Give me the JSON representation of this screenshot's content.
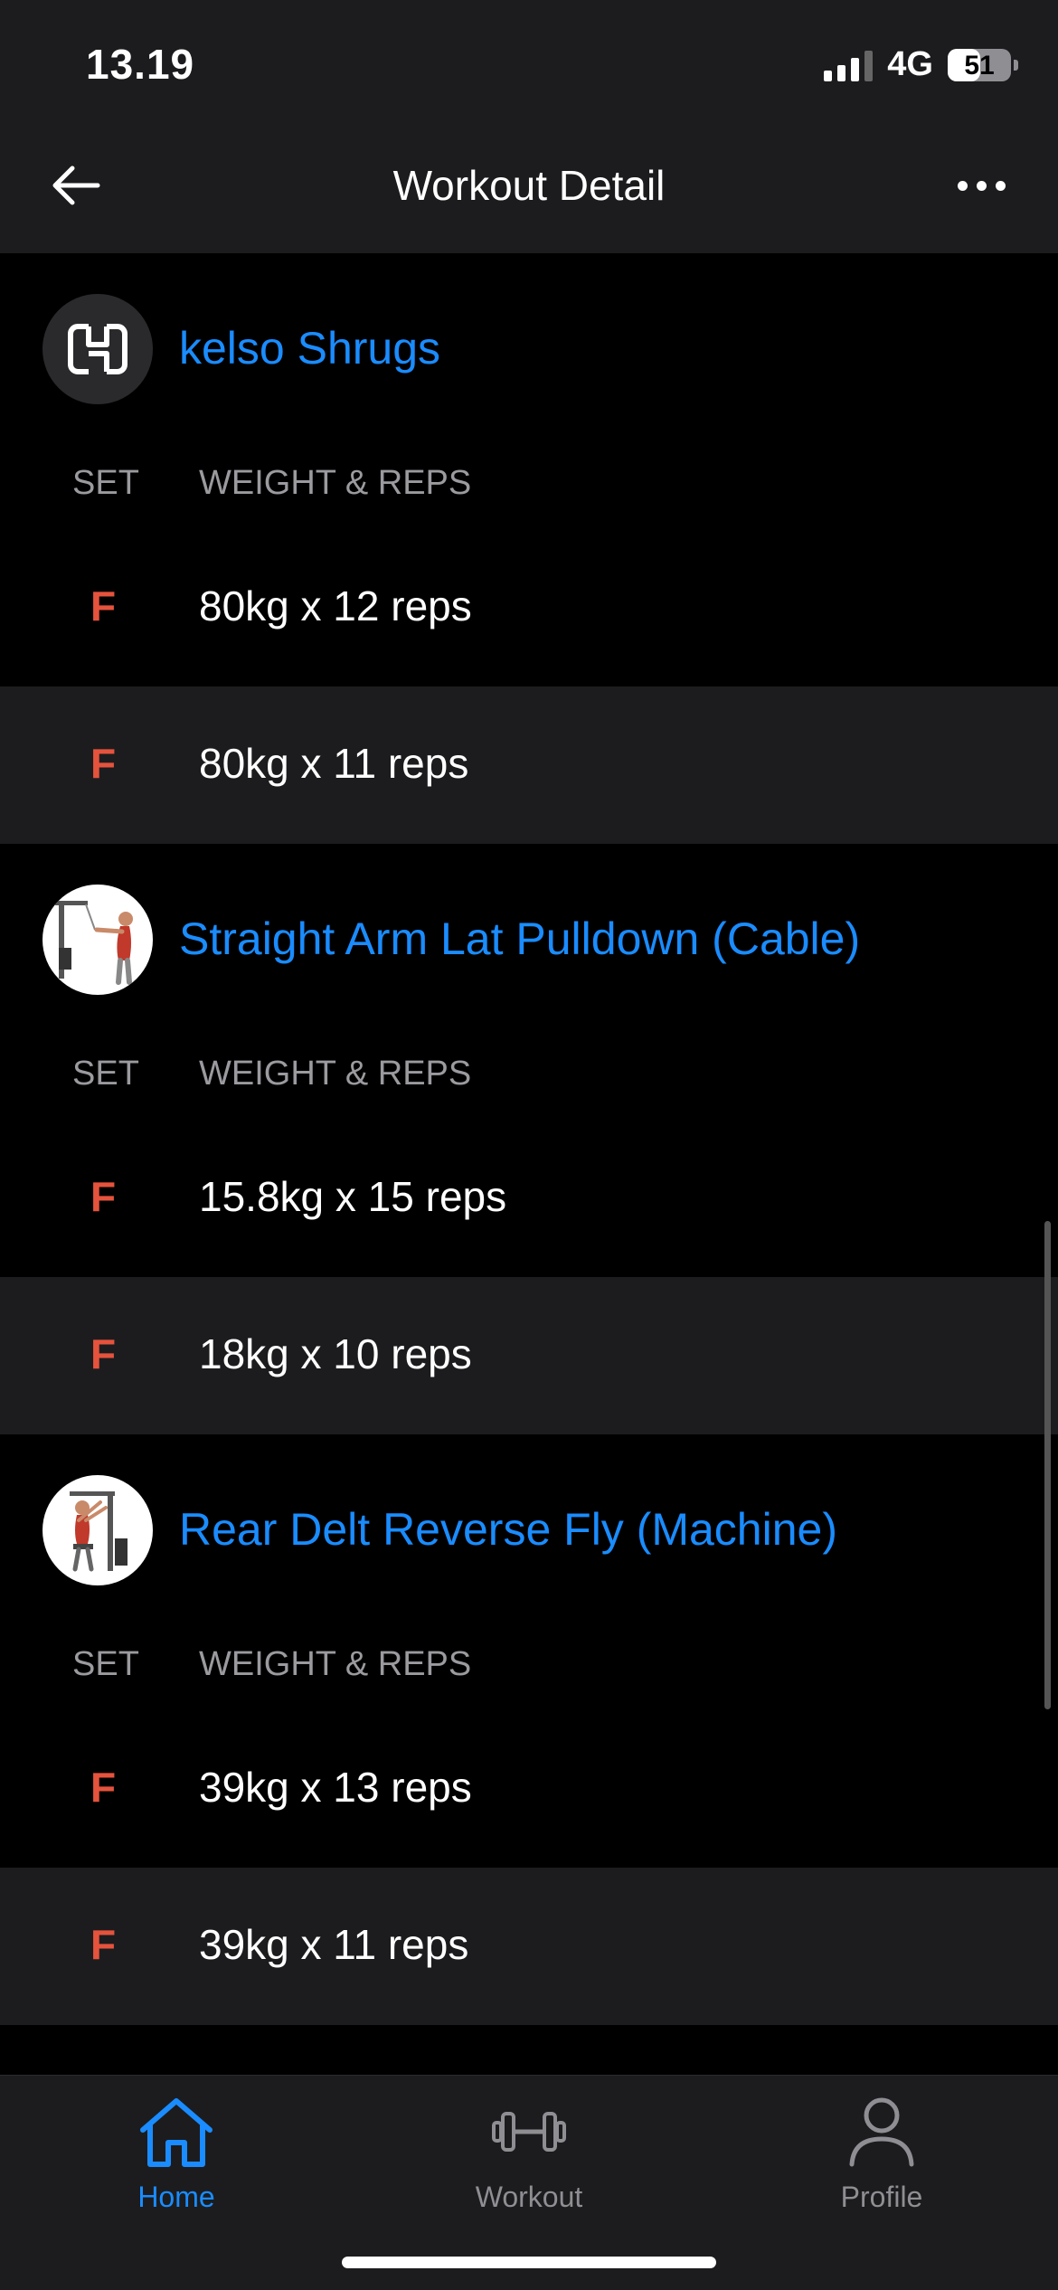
{
  "status_bar": {
    "time": "13.19",
    "network": "4G",
    "battery": "51",
    "battery_level": 0.51
  },
  "nav": {
    "title": "Workout Detail",
    "back_icon": "arrow-left-icon",
    "more_icon": "more-horizontal-icon"
  },
  "column_headers": {
    "set": "SET",
    "weight_reps": "WEIGHT & REPS"
  },
  "exercises": [
    {
      "name": "kelso Shrugs",
      "thumb_icon": "hevy-logo-icon",
      "sets": [
        {
          "type": "F",
          "value": "80kg x 12 reps"
        },
        {
          "type": "F",
          "value": "80kg x 11 reps"
        }
      ]
    },
    {
      "name": "Straight Arm Lat Pulldown (Cable)",
      "thumb_icon": "exercise-illustration-icon",
      "sets": [
        {
          "type": "F",
          "value": "15.8kg x 15 reps"
        },
        {
          "type": "F",
          "value": "18kg x 10 reps"
        }
      ]
    },
    {
      "name": "Rear Delt Reverse Fly (Machine)",
      "thumb_icon": "exercise-illustration-icon",
      "sets": [
        {
          "type": "F",
          "value": "39kg x 13 reps"
        },
        {
          "type": "F",
          "value": "39kg x 11 reps"
        }
      ]
    }
  ],
  "tab_bar": {
    "active": "Home",
    "tabs": [
      {
        "label": "Home",
        "icon": "home-icon"
      },
      {
        "label": "Workout",
        "icon": "dumbbell-icon"
      },
      {
        "label": "Profile",
        "icon": "user-icon"
      }
    ]
  },
  "colors": {
    "accent": "#1a8cff",
    "set_type": "#e5533d",
    "background": "#000000",
    "surface": "#1c1c1e",
    "muted_text": "#9a9a9f"
  }
}
